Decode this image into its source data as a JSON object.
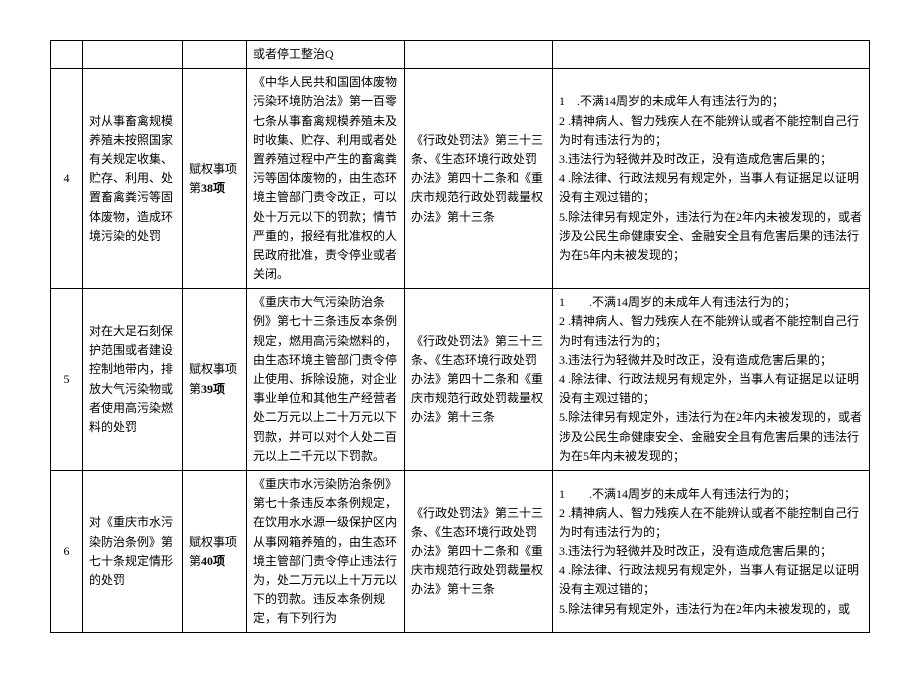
{
  "top_row": {
    "c1": "",
    "c2": "",
    "c3": "",
    "c4": "或者停工整治Q",
    "c5": "",
    "c6": ""
  },
  "rows": [
    {
      "num": "4",
      "title": "对从事畜禽规模养殖未按照国家有关规定收集、贮存、利用、处置畜禽粪污等固体废物，造成环境污染的处罚",
      "type_prefix": "赋权事项第",
      "type_bold": "38项",
      "basis": "《中华人民共和国固体废物污染环境防治法》第一百零七条从事畜禽规模养殖未及时收集、贮存、利用或者处置养殖过程中产生的畜禽粪污等固体废物的，由生态环境主管部门责令改正，可以处十万元以下的罚款；情节严重的，报经有批准权的人民政府批准，责令停业或者关闭。",
      "ref": "《行政处罚法》第三十三条、《生态环境行政处罚办法》第四十二条和《重庆市规范行政处罚裁量权办法》第十三条",
      "notes": "1　.不满14周岁的未成年人有违法行为的；\n2 .精神病人、智力残疾人在不能辨认或者不能控制自己行为时有违法行为的；\n3.违法行为轻微并及时改正，没有造成危害后果的；\n4 .除法律、行政法规另有规定外，当事人有证据足以证明没有主观过错的；\n5.除法律另有规定外，违法行为在2年内未被发现的，或者涉及公民生命健康安全、金融安全且有危害后果的违法行为在5年内未被发现的；"
    },
    {
      "num": "5",
      "title": "对在大足石刻保护范围或者建设控制地带内，排放大气污染物或者使用高污染燃料的处罚",
      "type_prefix": "赋权事项第",
      "type_bold": "39项",
      "basis": "《重庆市大气污染防治条例》第七十三条违反本条例规定，燃用高污染燃料的，由生态环境主管部门责令停止使用、拆除设施，对企业事业单位和其他生产经营者处二万元以上二十万元以下罚款，并可以对个人处二百元以上二千元以下罚款。",
      "ref": "《行政处罚法》第三十三条、《生态环境行政处罚办法》第四十二条和《重庆市规范行政处罚裁量权办法》第十三条",
      "notes": "1　　.不满14周岁的未成年人有违法行为的；\n2 .精神病人、智力残疾人在不能辨认或者不能控制自己行为时有违法行为的；\n3.违法行为轻微并及时改正，没有造成危害后果的；\n4 .除法律、行政法规另有规定外，当事人有证据足以证明没有主观过错的；\n5.除法律另有规定外，违法行为在2年内未被发现的，或者涉及公民生命健康安全、金融安全且有危害后果的违法行为在5年内未被发现的；"
    },
    {
      "num": "6",
      "title": "对《重庆市水污染防治条例》第七十条规定情形的处罚",
      "type_prefix": "赋权事项第",
      "type_bold": "40项",
      "basis": "《重庆市水污染防治条例》第七十条违反本条例规定，在饮用水水源一级保护区内从事网箱养殖的，由生态环境主管部门责令停止违法行为，处二万元以上十万元以下的罚款。违反本条例规定，有下列行为",
      "ref": "《行政处罚法》第三十三条、《生态环境行政处罚办法》第四十二条和《重庆市规范行政处罚裁量权办法》第十三条",
      "notes": "1　　.不满14周岁的未成年人有违法行为的；\n2 .精神病人、智力残疾人在不能辨认或者不能控制自己行为时有违法行为的；\n3.违法行为轻微并及时改正，没有造成危害后果的；\n4 .除法律、行政法规另有规定外，当事人有证据足以证明没有主观过错的；\n5.除法律另有规定外，违法行为在2年内未被发现的，或"
    }
  ]
}
